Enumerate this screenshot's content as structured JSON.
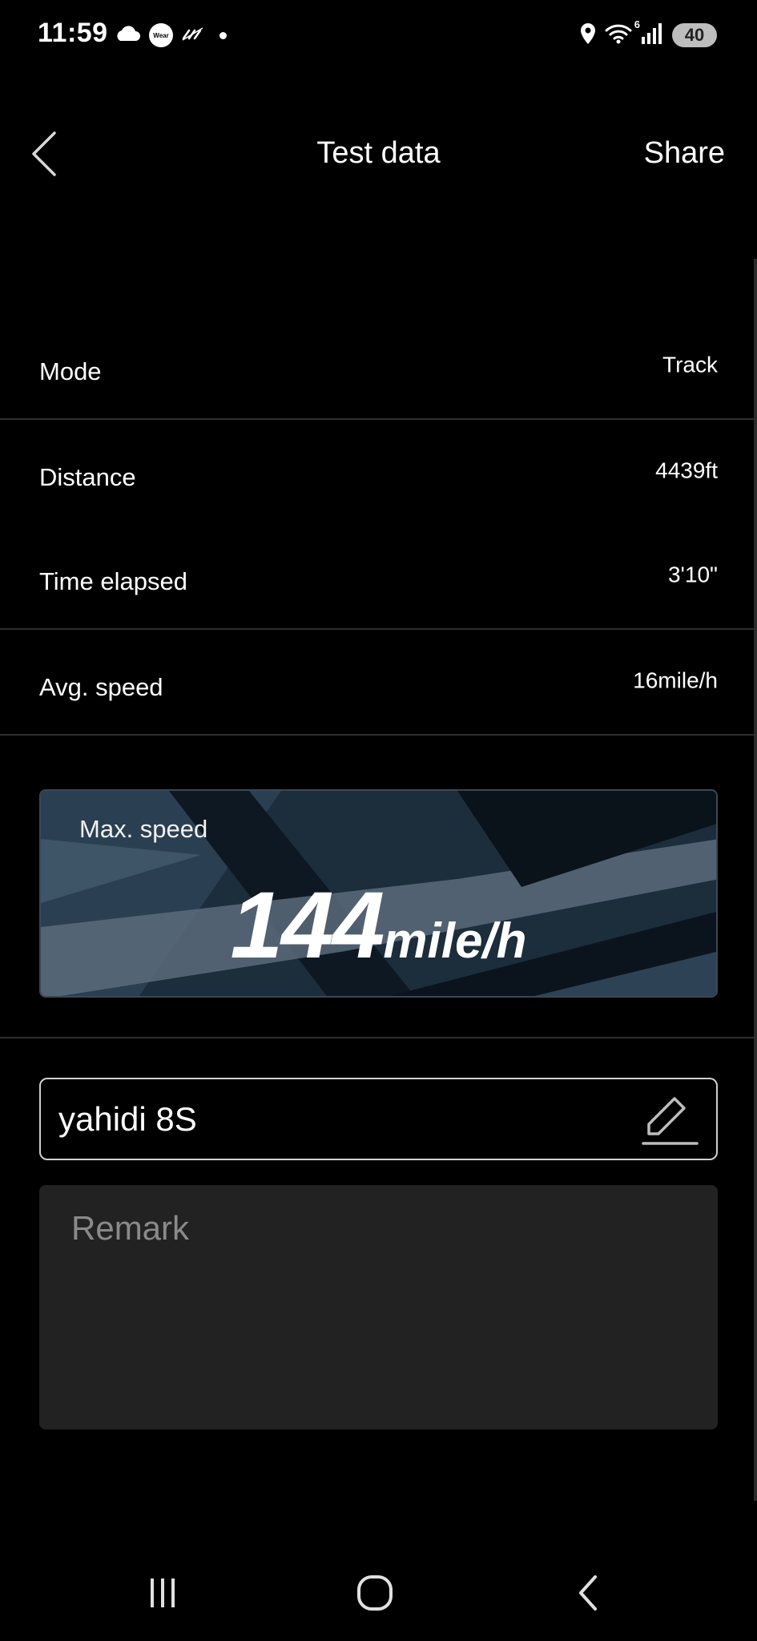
{
  "status_bar": {
    "time": "11:59",
    "left_icons": [
      "cloud-icon",
      "wear-icon",
      "no-signal-icon",
      "dot-icon"
    ],
    "wear_badge": "Wear",
    "wifi_label": "6",
    "battery": "40"
  },
  "header": {
    "title": "Test data",
    "share_label": "Share",
    "back_icon": "back-chevron-icon"
  },
  "rows": [
    {
      "label": "Mode",
      "value": "Track"
    },
    {
      "label": "Distance",
      "value": "4439ft"
    },
    {
      "label": "Time elapsed",
      "value": "3'10\""
    },
    {
      "label": "Avg. speed",
      "value": "16mile/h"
    }
  ],
  "max_speed": {
    "label": "Max. speed",
    "value": "144",
    "unit": "mile/h"
  },
  "name_field": {
    "value": "yahidi 8S",
    "edit_icon": "pencil-edit-icon"
  },
  "remark": {
    "placeholder": "Remark"
  },
  "nav_bar": {
    "buttons": [
      "recent-apps-icon",
      "home-icon",
      "back-icon"
    ]
  },
  "colors": {
    "background": "#000000",
    "divider": "#2f2f2f",
    "remark_bg": "#222222",
    "card_bg": "#1b2a38"
  }
}
